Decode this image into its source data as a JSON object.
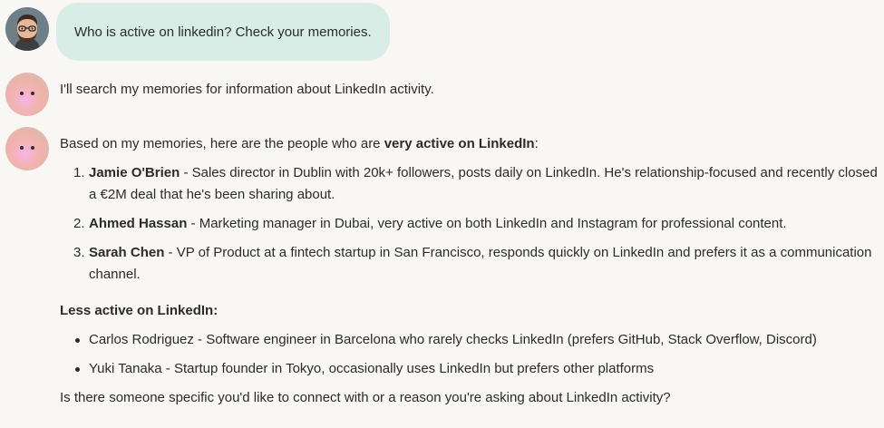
{
  "user_message": {
    "text": "Who is active on linkedin? Check your memories."
  },
  "assistant_message_1": {
    "text": "I'll search my memories for information about LinkedIn activity."
  },
  "assistant_message_2": {
    "intro_prefix": "Based on my memories, here are the people who are ",
    "intro_bold": "very active on LinkedIn",
    "intro_suffix": ":",
    "very_active": [
      {
        "number": "1.",
        "name": "Jamie O'Brien",
        "desc": " - Sales director in Dublin with 20k+ followers, posts daily on LinkedIn. He's relationship-focused and recently closed a €2M deal that he's been sharing about."
      },
      {
        "number": "2.",
        "name": "Ahmed Hassan",
        "desc": " - Marketing manager in Dubai, very active on both LinkedIn and Instagram for professional content."
      },
      {
        "number": "3.",
        "name": "Sarah Chen",
        "desc": " - VP of Product at a fintech startup in San Francisco, responds quickly on LinkedIn and prefers it as a communication channel."
      }
    ],
    "less_active_heading": "Less active on LinkedIn:",
    "less_active": [
      "Carlos Rodriguez - Software engineer in Barcelona who rarely checks LinkedIn (prefers GitHub, Stack Overflow, Discord)",
      "Yuki Tanaka - Startup founder in Tokyo, occasionally uses LinkedIn but prefers other platforms"
    ],
    "closing": "Is there someone specific you'd like to connect with or a reason you're asking about LinkedIn activity?"
  },
  "colors": {
    "background": "#f9f7f3",
    "user_bubble": "#d8ede6",
    "text": "#2b2b2b"
  },
  "icons": {
    "user_avatar": "user-avatar-icon",
    "assistant_avatar": "assistant-avatar-icon"
  }
}
